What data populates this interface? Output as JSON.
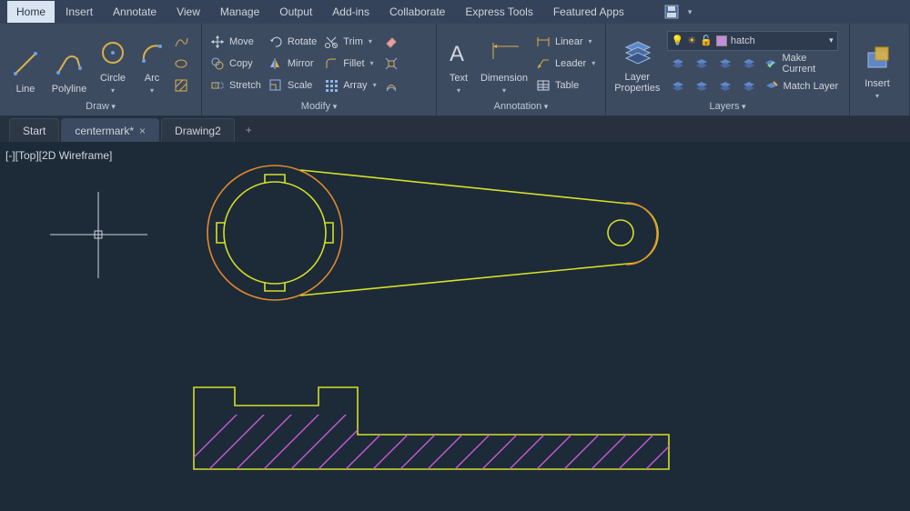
{
  "tabs": {
    "items": [
      "Home",
      "Insert",
      "Annotate",
      "View",
      "Manage",
      "Output",
      "Add-ins",
      "Collaborate",
      "Express Tools",
      "Featured Apps"
    ],
    "active": "Home"
  },
  "ribbon": {
    "draw": {
      "title": "Draw",
      "line": "Line",
      "polyline": "Polyline",
      "circle": "Circle",
      "arc": "Arc"
    },
    "modify": {
      "title": "Modify",
      "move": "Move",
      "rotate": "Rotate",
      "trim": "Trim",
      "copy": "Copy",
      "mirror": "Mirror",
      "fillet": "Fillet",
      "stretch": "Stretch",
      "scale": "Scale",
      "array": "Array"
    },
    "annotation": {
      "title": "Annotation",
      "text": "Text",
      "dimension": "Dimension",
      "linear": "Linear",
      "leader": "Leader",
      "table": "Table"
    },
    "layers": {
      "title": "Layers",
      "properties": "Layer\nProperties",
      "current_layer": "hatch",
      "make_current": "Make Current",
      "match_layer": "Match Layer"
    },
    "block": {
      "insert": "Insert"
    }
  },
  "file_tabs": {
    "start": "Start",
    "active": "centermark*",
    "other": "Drawing2",
    "plus": "+"
  },
  "viewport_label": "[-][Top][2D Wireframe]",
  "colors": {
    "ui_bg": "#3d4b61",
    "draw_yellow": "#d4e028",
    "draw_orange": "#e08a2e",
    "hatch_magenta": "#c75ad6"
  }
}
